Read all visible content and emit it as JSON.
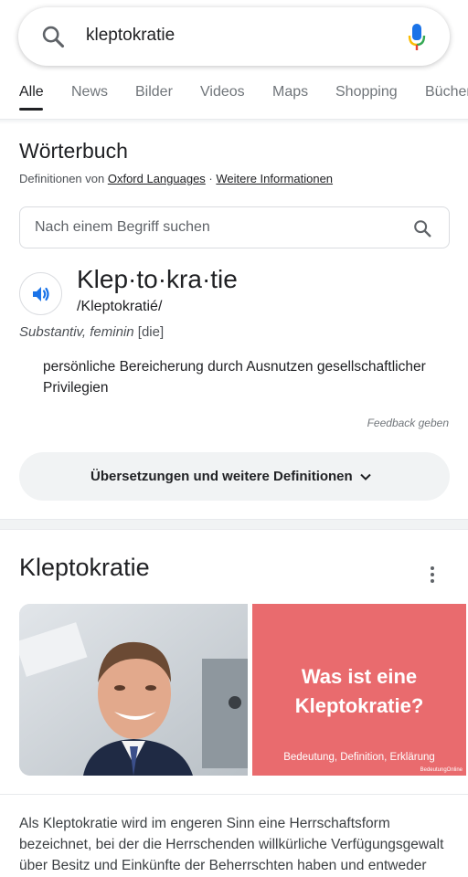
{
  "search": {
    "query": "kleptokratie"
  },
  "tabs": [
    {
      "label": "Alle"
    },
    {
      "label": "News"
    },
    {
      "label": "Bilder"
    },
    {
      "label": "Videos"
    },
    {
      "label": "Maps"
    },
    {
      "label": "Shopping"
    },
    {
      "label": "Bücher"
    }
  ],
  "dictionary": {
    "title": "Wörterbuch",
    "source_prefix": "Definitionen von ",
    "source_link": "Oxford Languages",
    "source_sep": " · ",
    "more_info": "Weitere Informationen",
    "search_placeholder": "Nach einem Begriff suchen",
    "headword": "Klep·to·kra·tie",
    "phonetic": "/Kleptokratié/",
    "part_of_speech": "Substantiv, feminin",
    "article": " [die]",
    "definition": "persönliche Bereicherung durch Ausnutzen gesellschaftlicher Privilegien",
    "feedback": "Feedback geben",
    "more_definitions": "Übersetzungen und weitere Definitionen"
  },
  "knowledge_panel": {
    "title": "Kleptokratie",
    "image2_line1": "Was ist eine",
    "image2_line2": "Kleptokratie?",
    "image2_caption": "Bedeutung, Definition, Erklärung",
    "image2_watermark": "BedeutungOnline",
    "description": "Als Kleptokratie wird im engeren Sinn eine Herrschaftsform bezeichnet, bei der die Herrschenden willkürliche Verfügungsgewalt über Besitz und Einkünfte der Beherrschten haben und entweder"
  },
  "colors": {
    "accent_blue": "#1a73e8",
    "mic_red": "#ea4335",
    "mic_yellow": "#fbbc04",
    "mic_green": "#34a853",
    "image2_bg": "#e96b6e"
  }
}
